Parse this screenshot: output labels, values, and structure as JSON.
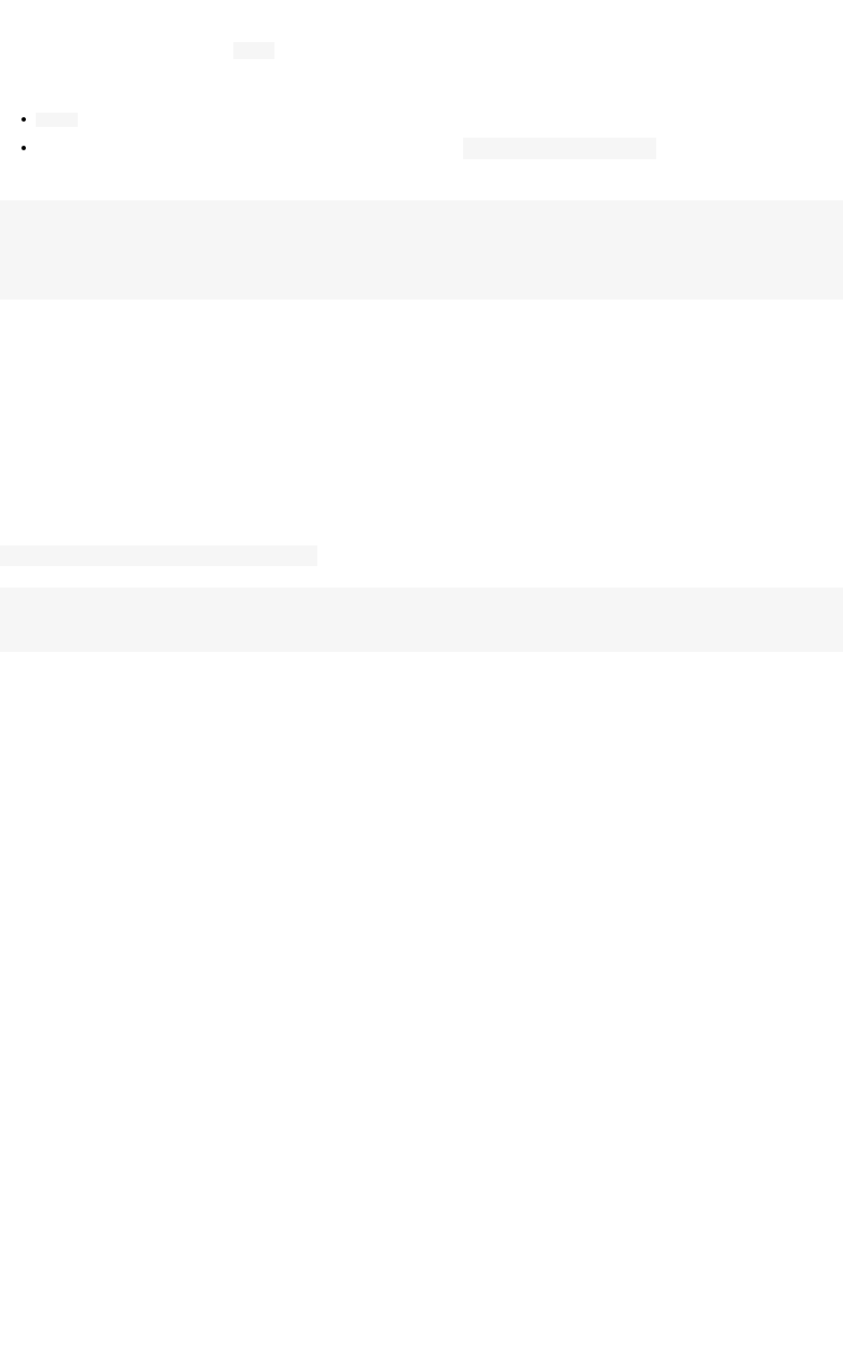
{
  "header": {
    "topPillLabel": " "
  },
  "list": {
    "items": [
      {
        "label": " "
      },
      {
        "label": " "
      }
    ]
  },
  "hero": {
    "content": " "
  },
  "midPill": {
    "label": " "
  },
  "band": {
    "content": " "
  }
}
